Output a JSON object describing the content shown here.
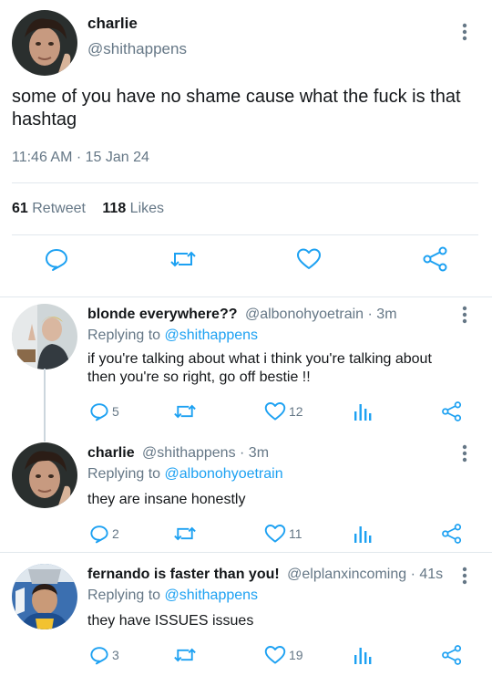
{
  "main_tweet": {
    "name": "charlie",
    "handle": "@shithappens",
    "text": "some of you have no shame cause what the fuck is that hashtag",
    "timestamp": "11:46 AM · 15 Jan 24",
    "retweets": "61",
    "retweets_label": "Retweet",
    "likes": "118",
    "likes_label": "Likes"
  },
  "replies": [
    {
      "name": "blonde everywhere??",
      "handle": "@albonohyoetrain",
      "time": "· 3m",
      "replying_prefix": "Replying to",
      "replying_to": "@shithappens",
      "text": "if you're talking about what i think you're talking about then you're so right, go off bestie !!",
      "reply_count": "5",
      "like_count": "12"
    },
    {
      "name": "charlie",
      "handle": "@shithappens",
      "time": "· 3m",
      "replying_prefix": "Replying to",
      "replying_to": "@albonohyoetrain",
      "text": "they are insane honestly",
      "reply_count": "2",
      "like_count": "11"
    },
    {
      "name": "fernando is faster than you!",
      "handle": "@elplanxincoming",
      "time": "· 41s",
      "replying_prefix": "Replying to",
      "replying_to": "@shithappens",
      "text": "they have ISSUES issues",
      "reply_count": "3",
      "like_count": "19"
    }
  ],
  "colors": {
    "text": "#14171a",
    "muted": "#657786",
    "link": "#1da1f2",
    "icon": "#1da1f2",
    "divider": "#e1e8ed"
  }
}
